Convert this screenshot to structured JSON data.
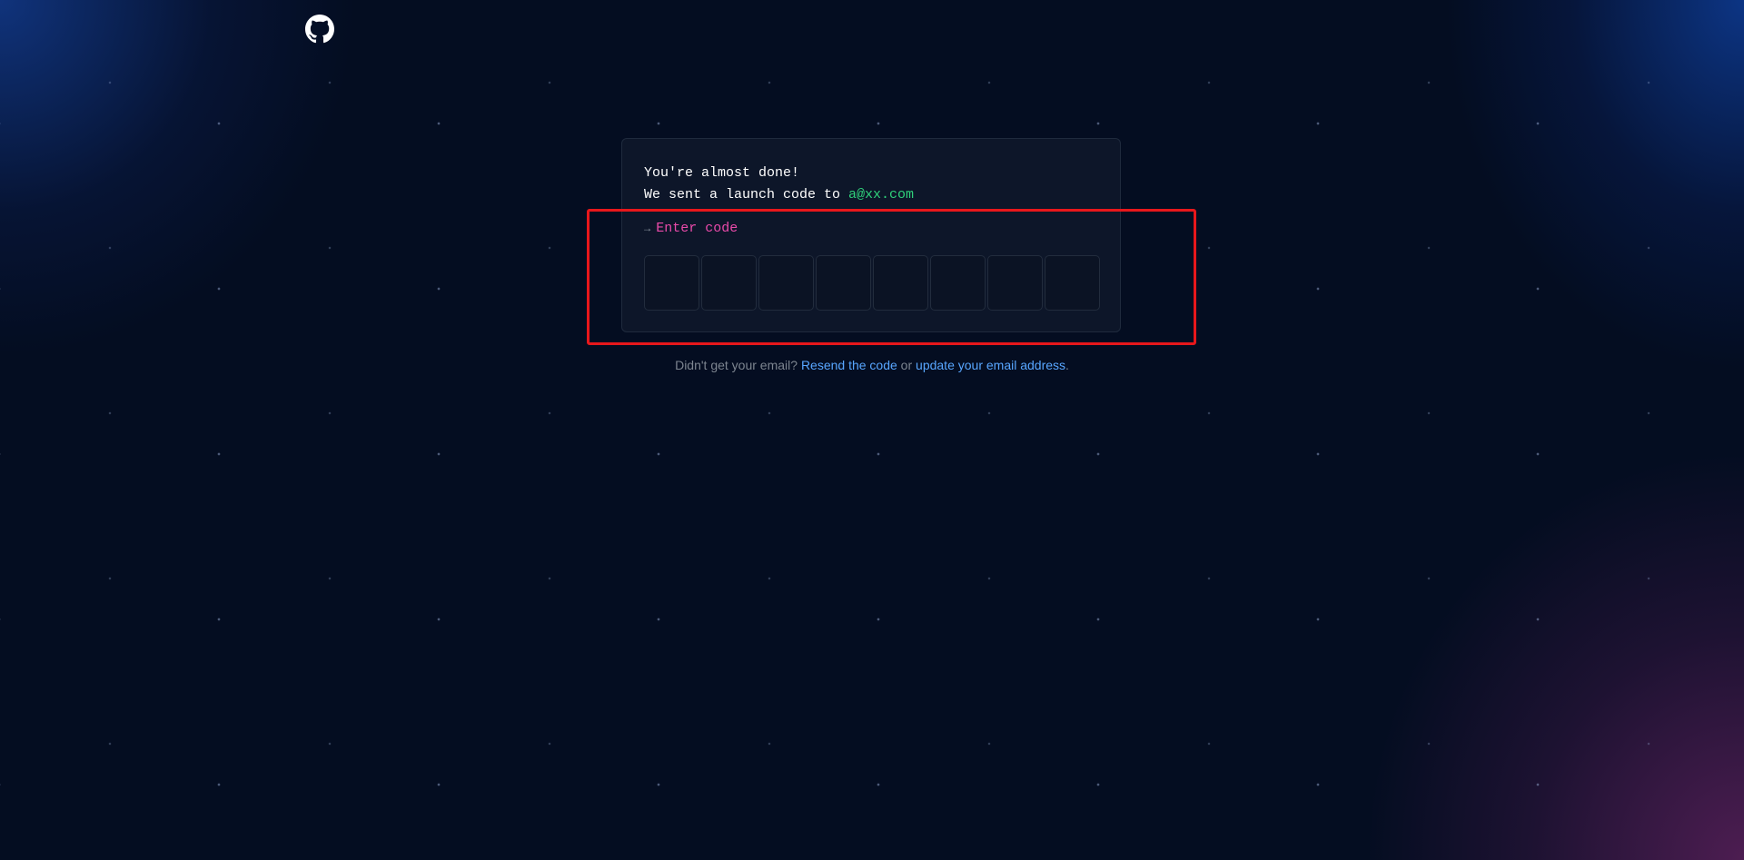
{
  "header": {
    "logo_icon": "github-logo-icon"
  },
  "card": {
    "line1": "You're almost done!",
    "line2_prefix": "We sent a launch code to ",
    "email": "a@xx.com",
    "prompt_arrow": "→",
    "prompt_label": "Enter code",
    "code_digits": [
      "",
      "",
      "",
      "",
      "",
      "",
      "",
      ""
    ]
  },
  "footer": {
    "question": "Didn't get your email? ",
    "resend_link": "Resend the code",
    "or_text": " or ",
    "update_link": "update your email address",
    "end": "."
  },
  "colors": {
    "background": "#040d21",
    "card_bg": "#0d1629",
    "email_green": "#2fd07a",
    "prompt_pink": "#ea4aaa",
    "link_blue": "#58a6ff",
    "highlight_red": "#e8171b"
  }
}
